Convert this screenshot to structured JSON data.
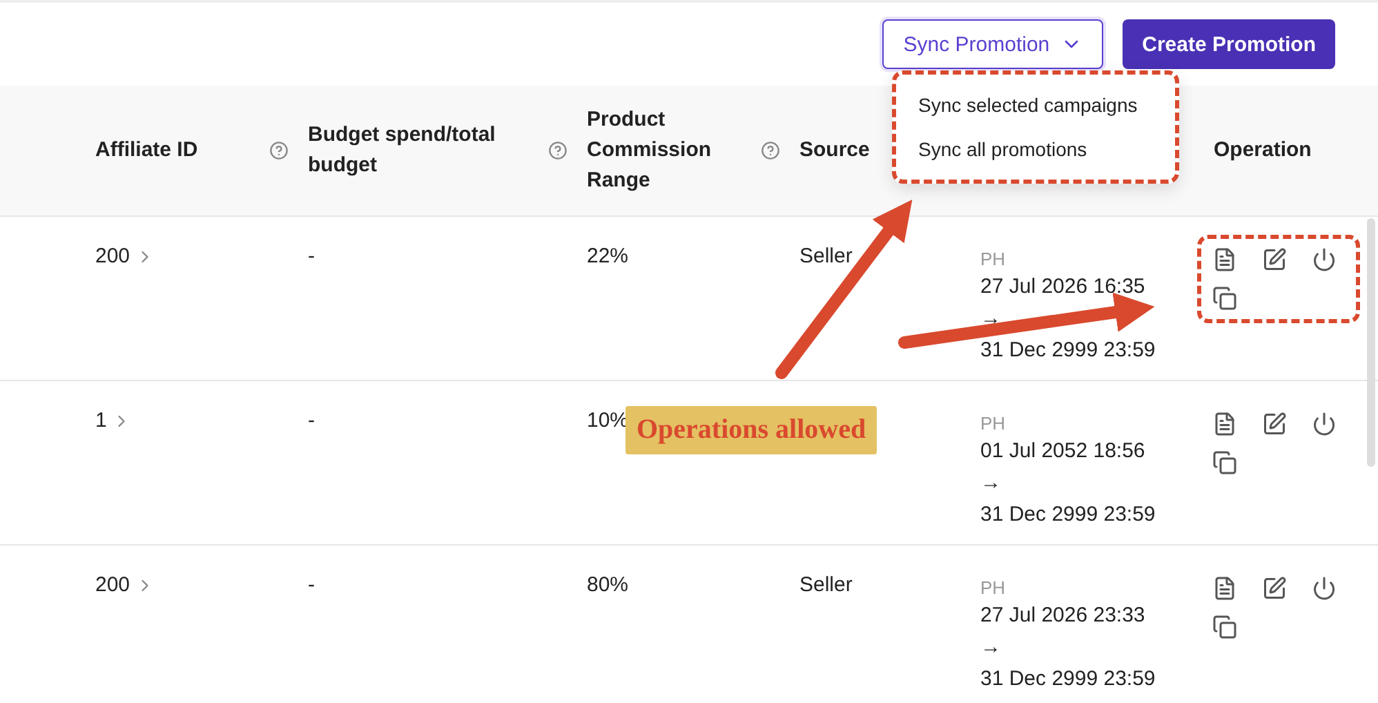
{
  "toolbar": {
    "sync_button": {
      "label": "Sync Promotion",
      "expanded": true
    },
    "create_button": {
      "label": "Create Promotion"
    }
  },
  "sync_menu": {
    "items": [
      {
        "label": "Sync selected campaigns"
      },
      {
        "label": "Sync all promotions"
      }
    ]
  },
  "table": {
    "columns": [
      {
        "label": "Affiliate ID",
        "help": true
      },
      {
        "label": "Budget spend/total budget",
        "help": true
      },
      {
        "label": "Product Commission Range",
        "help": true
      },
      {
        "label": "Source",
        "help": false
      },
      {
        "label": "Operation",
        "help": false
      }
    ],
    "rows": [
      {
        "affiliate_id": "200",
        "budget": "-",
        "commission": "22%",
        "source": "Seller",
        "region": "PH",
        "start": "27 Jul 2026 16:35",
        "arrow": "→",
        "end": "31 Dec 2999 23:59",
        "operations_highlighted": true
      },
      {
        "affiliate_id": "1",
        "budget": "-",
        "commission": "10%",
        "region": "PH",
        "start": "01 Jul 2052 18:56",
        "arrow": "→",
        "end": "31 Dec 2999 23:59",
        "operations_highlighted": false
      },
      {
        "affiliate_id": "200",
        "budget": "-",
        "commission": "80%",
        "source": "Seller",
        "region": "PH",
        "start": "27 Jul 2026 23:33",
        "arrow": "→",
        "end": "31 Dec 2999 23:59",
        "operations_highlighted": false
      }
    ]
  },
  "annotation": {
    "label": "Operations allowed"
  }
}
